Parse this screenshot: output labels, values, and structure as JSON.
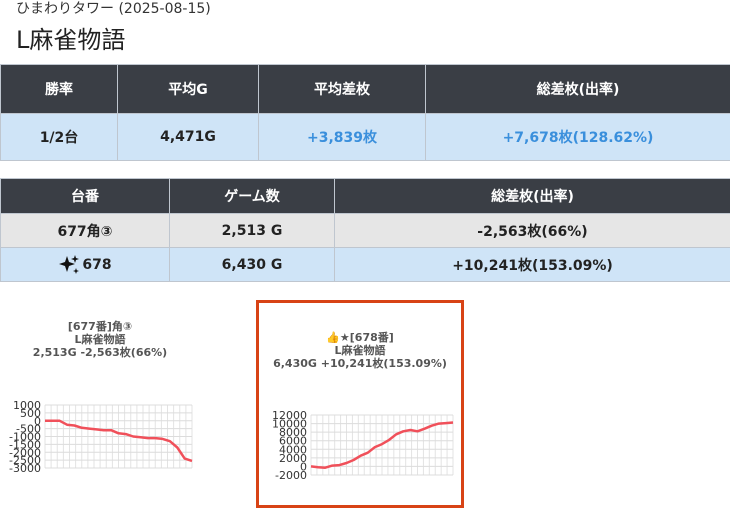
{
  "header": {
    "subtitle": "ひまわりタワー (2025-08-15)",
    "title": "L麻雀物語"
  },
  "summary": {
    "headers": [
      "勝率",
      "平均G",
      "平均差枚",
      "総差枚(出率)"
    ],
    "values": [
      "1/2台",
      "4,471G",
      "+3,839枚",
      "+7,678枚(128.62%)"
    ]
  },
  "machines": {
    "headers": [
      "台番",
      "ゲーム数",
      "総差枚(出率)"
    ],
    "rows": [
      {
        "number": "677角③",
        "games": "2,513 G",
        "diff": "-2,563枚(66%)"
      },
      {
        "number": "678",
        "games": "6,430 G",
        "diff": "+10,241枚(153.09%)"
      }
    ]
  },
  "colors": {
    "header_bg": "#3a3e45",
    "highlight_bg": "#cfe4f7",
    "positive_text": "#3a8fdc",
    "line": "#f0505a",
    "selected_border": "#d84315"
  },
  "chart_data": [
    {
      "type": "line",
      "title_lines": [
        "[677番]角③",
        "L麻雀物語",
        "2,513G -2,563枚(66%)"
      ],
      "ylim": [
        -3000,
        1000
      ],
      "yticks": [
        1000,
        500,
        0,
        -500,
        -1000,
        -1500,
        -2000,
        -2500,
        -3000
      ],
      "x": [
        0,
        1,
        2,
        3,
        4,
        5,
        6,
        7,
        8,
        9,
        10,
        11,
        12,
        13,
        14,
        15,
        16,
        17,
        18,
        19,
        20
      ],
      "values": [
        0,
        0,
        0,
        -250,
        -300,
        -450,
        -500,
        -550,
        -600,
        -600,
        -800,
        -850,
        -1000,
        -1050,
        -1100,
        -1100,
        -1150,
        -1300,
        -1700,
        -2400,
        -2550
      ],
      "grid": true
    },
    {
      "type": "line",
      "title_lines": [
        "👍★[678番]",
        "L麻雀物語",
        "6,430G +10,241枚(153.09%)"
      ],
      "ylim": [
        -2000,
        12000
      ],
      "yticks": [
        12000,
        10000,
        8000,
        6000,
        4000,
        2000,
        0,
        -2000
      ],
      "x": [
        0,
        1,
        2,
        3,
        4,
        5,
        6,
        7,
        8,
        9,
        10,
        11,
        12,
        13,
        14,
        15,
        16,
        17,
        18,
        19,
        20
      ],
      "values": [
        0,
        -200,
        -300,
        200,
        300,
        800,
        1500,
        2500,
        3200,
        4500,
        5200,
        6200,
        7500,
        8200,
        8500,
        8200,
        8800,
        9500,
        10000,
        10100,
        10241
      ],
      "grid": true
    }
  ]
}
